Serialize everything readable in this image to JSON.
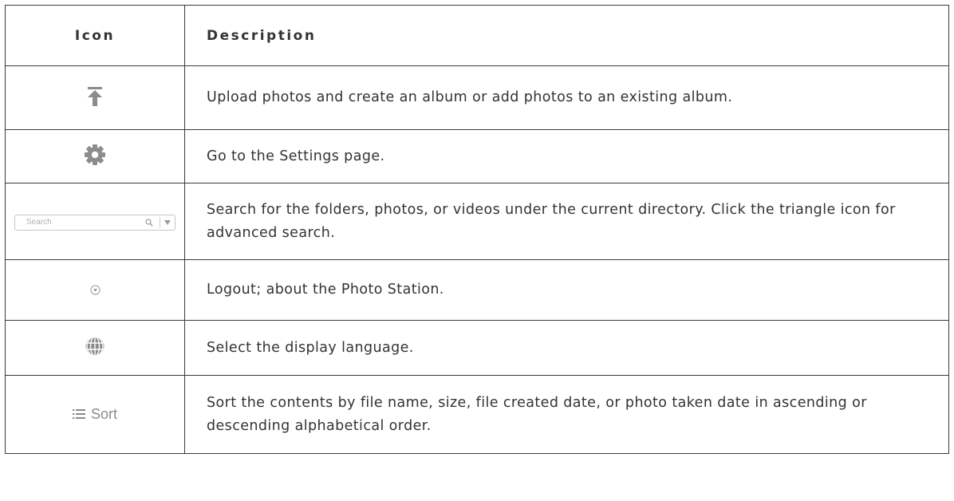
{
  "table": {
    "headers": {
      "icon": "Icon",
      "description": "Description"
    },
    "rows": [
      {
        "icon": "upload-icon",
        "description": "Upload photos and create an album or add photos to an existing album."
      },
      {
        "icon": "gear-icon",
        "description": "Go to the Settings page."
      },
      {
        "icon": "search-box",
        "search_placeholder": "Search",
        "description": "Search for the folders, photos, or videos under the current directory. Click the triangle icon for advanced search."
      },
      {
        "icon": "circle-chevron-down-icon",
        "description": "Logout; about the Photo Station."
      },
      {
        "icon": "globe-icon",
        "description": "Select the display language."
      },
      {
        "icon": "sort-button",
        "sort_label": "Sort",
        "description": "Sort the contents by file name, size, file created date, or photo taken date in ascending or descending alphabetical order."
      }
    ]
  },
  "colors": {
    "text": "#333333",
    "border": "#3a3a3a",
    "icon_gray": "#8c8c8c"
  }
}
